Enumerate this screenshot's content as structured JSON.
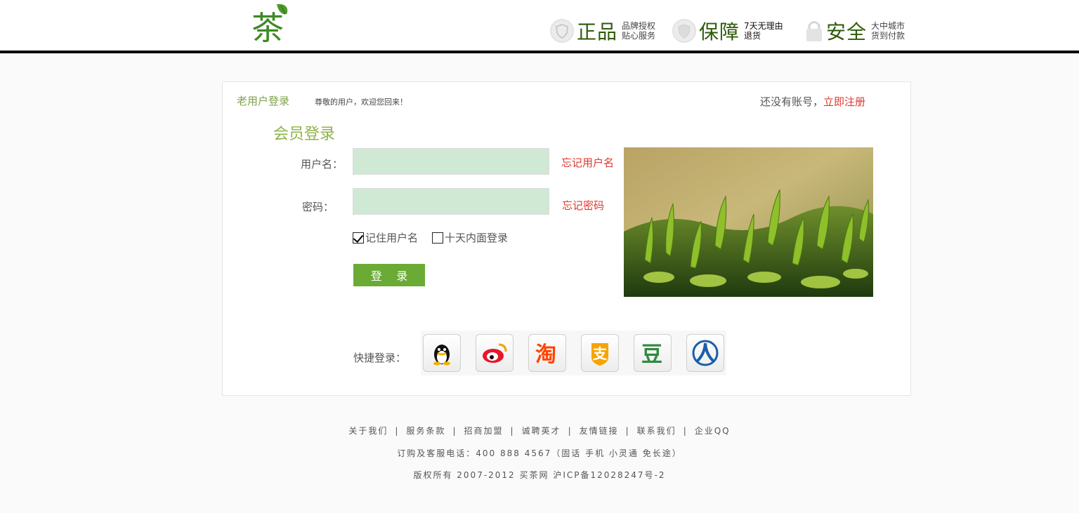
{
  "header": {
    "logo_text": "茶",
    "badges": [
      {
        "big": "正品",
        "line1": "品牌授权",
        "line2": "贴心服务"
      },
      {
        "big": "保障",
        "line1": "7天无理由",
        "line2": "退货"
      },
      {
        "big": "安全",
        "line1": "大中城市",
        "line2": "货到付款"
      }
    ]
  },
  "panel": {
    "tab_title": "老用户登录",
    "welcome": "尊敬的用户，欢迎您回来！",
    "no_account": "还没有账号，",
    "register_link": "立即注册",
    "member_title": "会员登录",
    "username_label": "用户名：",
    "username_value": "",
    "forgot_username": "忘记用户名",
    "password_label": "密码：",
    "password_value": "",
    "forgot_password": "忘记密码",
    "remember_username": {
      "label": "记住用户名",
      "checked": true
    },
    "ten_days_login": {
      "label": "十天内面登录",
      "checked": false
    },
    "login_button": "登 录",
    "quick_login_label": "快捷登录：",
    "quick_login_providers": [
      "qq-icon",
      "weibo-icon",
      "taobao-icon",
      "alipay-icon",
      "douban-icon",
      "renren-icon"
    ]
  },
  "footer": {
    "links": [
      "关于我们",
      "服务条款",
      "招商加盟",
      "诚聘英才",
      "友情链接",
      "联系我们",
      "企业QQ"
    ],
    "separator": "|",
    "phone_line": "订购及客服电话：400 888 4567（固话 手机 小灵通 免长途）",
    "copyright": "版权所有 2007-2012 买茶网 沪ICP备12028247号-2"
  },
  "colors": {
    "accent_green": "#6aaa35",
    "title_green": "#8fb34a",
    "link_red": "#e0382e",
    "input_bg": "#cfe9d4",
    "badge_green": "#2d5a0a"
  }
}
